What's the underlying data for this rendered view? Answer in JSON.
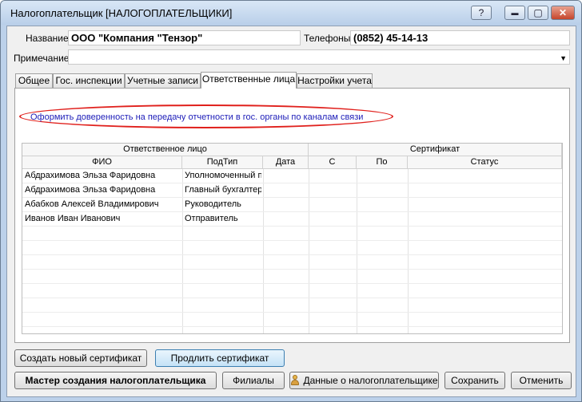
{
  "window": {
    "title": "Налогоплательщик [НАЛОГОПЛАТЕЛЬЩИКИ]",
    "help_label": "?",
    "minimize_label": "▬",
    "maximize_label": "▢",
    "close_label": "✕"
  },
  "form": {
    "name_label": "Название",
    "name_value": "ООО \"Компания \"Тензор\"",
    "phones_label": "Телефоны",
    "phones_value": "(0852) 45-14-13",
    "note_label": "Примечание",
    "note_value": ""
  },
  "tabs": [
    {
      "label": "Общее"
    },
    {
      "label": "Гос. инспекции"
    },
    {
      "label": "Учетные записи"
    },
    {
      "label": "Ответственные лица"
    },
    {
      "label": "Настройки учета"
    }
  ],
  "panel": {
    "link_text": "Оформить доверенность на передачу отчетности в гос. органы по каналам связи",
    "highlight_color": "#e0201c"
  },
  "table": {
    "group_headers": {
      "responsible": "Ответственное лицо",
      "certificate": "Сертификат"
    },
    "columns": [
      "ФИО",
      "ПодТип",
      "Дата",
      "С",
      "По",
      "Статус"
    ],
    "rows": [
      {
        "fio": "Абдрахимова Эльза Фаридовна",
        "subtype": "Уполномоченный п",
        "date": "",
        "from": "",
        "to": "",
        "status": ""
      },
      {
        "fio": "Абдрахимова Эльза Фаридовна",
        "subtype": "Главный бухгалтер",
        "date": "",
        "from": "",
        "to": "",
        "status": ""
      },
      {
        "fio": "Абабков Алексей Владимирович",
        "subtype": "Руководитель",
        "date": "",
        "from": "",
        "to": "",
        "status": ""
      },
      {
        "fio": "Иванов Иван Иванович",
        "subtype": "Отправитель",
        "date": "",
        "from": "",
        "to": "",
        "status": ""
      }
    ]
  },
  "buttons": {
    "create_cert": "Создать новый сертификат",
    "renew_cert": "Продлить сертификат",
    "wizard": "Мастер создания налогоплательщика",
    "branches": "Филиалы",
    "taxpayer_data": "Данные о налогоплательщике",
    "save": "Сохранить",
    "cancel": "Отменить"
  },
  "icons": {
    "dropdown": "chevron-down-icon",
    "taxpayer_data": "person-icon"
  }
}
